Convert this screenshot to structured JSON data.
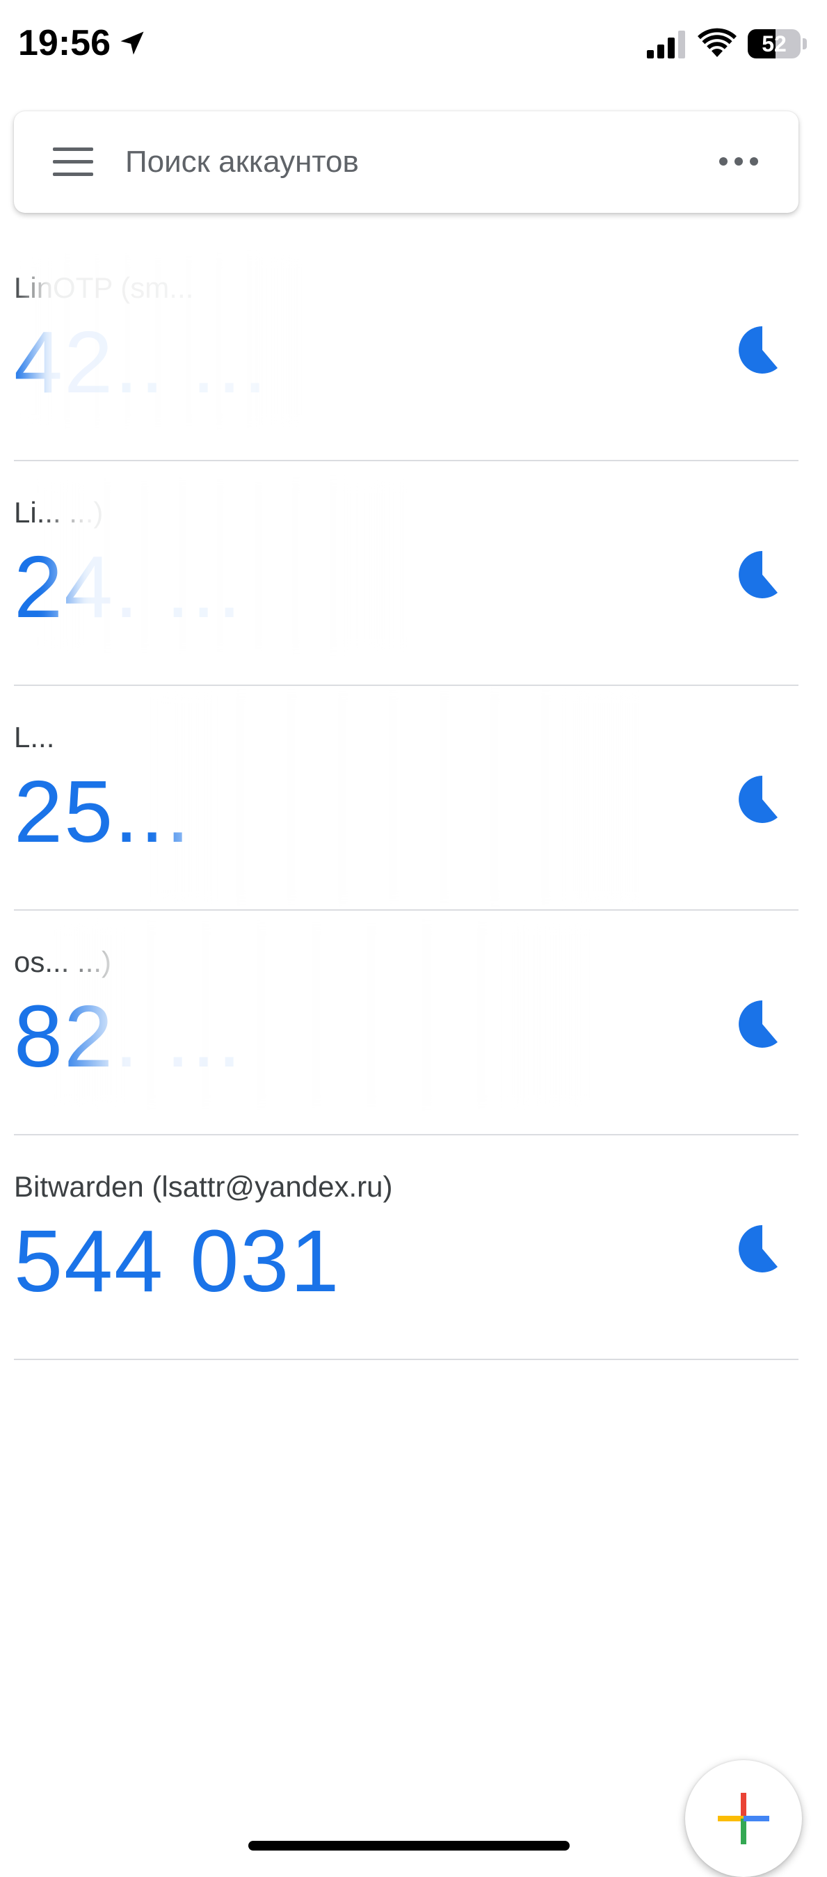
{
  "status_bar": {
    "time": "19:56",
    "battery_percent": "52",
    "battery_level": 0.52,
    "icons": [
      "location-arrow-icon",
      "cellular-signal-icon",
      "wifi-icon",
      "battery-icon"
    ]
  },
  "search": {
    "placeholder": "Поиск аккаунтов",
    "value": ""
  },
  "accounts": [
    {
      "name": "LinOTP (sm...",
      "code": "42.. ...",
      "obscured": true
    },
    {
      "name": "Li... ...)",
      "code": "24. ...",
      "obscured": true
    },
    {
      "name": "L...",
      "code": "25...",
      "obscured": true
    },
    {
      "name": "os... ...)",
      "code": "82. ...",
      "obscured": true
    },
    {
      "name": "Bitwarden (lsattr@yandex.ru)",
      "code": "544 031",
      "obscured": false
    }
  ],
  "colors": {
    "code_blue": "#1a73e8",
    "timer_blue": "#1a73e8",
    "divider": "#dadce0",
    "plus_red": "#ea4335",
    "plus_yellow": "#fbbc04",
    "plus_green": "#34a853",
    "plus_blue": "#4285f4"
  },
  "fab": {
    "icon": "add-plus-icon"
  }
}
